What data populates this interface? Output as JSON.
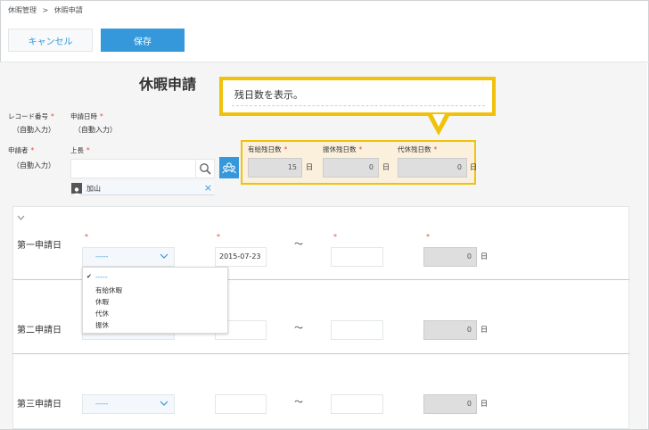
{
  "breadcrumb": {
    "parent": "休暇管理",
    "sep": ">",
    "current": "休暇申請"
  },
  "toolbar": {
    "cancel_label": "キャンセル",
    "save_label": "保存"
  },
  "form": {
    "title": "休暇申請",
    "record_no": {
      "label": "レコード番号",
      "value": "（自動入力）"
    },
    "apply_datetime": {
      "label": "申請日時",
      "value": "（自動入力）"
    },
    "applicant": {
      "label": "申請者",
      "value": "（自動入力）"
    },
    "boss": {
      "label": "上長",
      "user": "加山"
    },
    "required_mark": "*"
  },
  "remaining": {
    "paid": {
      "label": "有給残日数",
      "value": "15",
      "unit": "日"
    },
    "substitute": {
      "label": "振休残日数",
      "value": "0",
      "unit": "日"
    },
    "compensatory": {
      "label": "代休残日数",
      "value": "0",
      "unit": "日"
    }
  },
  "callout": {
    "text": "残日数を表示。"
  },
  "table": {
    "rows": [
      {
        "label": "第一申請日",
        "select": "-----",
        "date": "2015-07-23",
        "days": "0",
        "unit": "日"
      },
      {
        "label": "第二申請日",
        "days": "0",
        "unit": "日"
      },
      {
        "label": "第三申請日",
        "select": "-----",
        "days": "0",
        "unit": "日"
      }
    ],
    "tilde": "〜"
  },
  "dropdown": {
    "options": [
      "-----",
      "有給休暇",
      "休暇",
      "代休",
      "振休"
    ]
  },
  "colors": {
    "accent": "#3498db",
    "highlight": "#f0c20c",
    "required": "#e74c3c"
  }
}
